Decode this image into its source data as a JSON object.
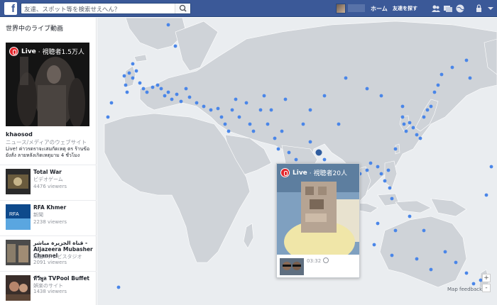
{
  "header": {
    "search_placeholder": "友達、スポット等を検索せえへん？",
    "nav_home": "ホーム",
    "nav_find_friends": "友達を探す"
  },
  "sidebar": {
    "title": "世界中のライブ動画",
    "featured": {
      "live_label": "Live",
      "viewers": "· 視聴者1.5万人",
      "name": "khaosod",
      "category": "ニュース/メディアのウェブサイト",
      "description": "Live! ค่าวรดราจะเสมกัดเหตุ ตร ร้านข้อยังสั่ง ลายหลังเกิดเหตุมาม 4 ชั่วโมง"
    },
    "streams": [
      {
        "name": "Total War",
        "category": "ビデオゲーム",
        "viewers": "4476 viewers"
      },
      {
        "name": "RFA Khmer",
        "category": "新聞",
        "viewers": "2238 viewers"
      },
      {
        "name": "قناة الجزيرة مباشر - Aljazeera Mubasher Channel",
        "category": "映画&テレビスタジオ",
        "viewers": "2091 viewers"
      },
      {
        "name": "ทีวีพูล TVPool Buffet",
        "category": "娯楽のサイト",
        "viewers": "1438 viewers"
      }
    ]
  },
  "popup": {
    "live_label": "Live",
    "viewers": "· 視聴者20人",
    "duration": "03:32"
  },
  "map": {
    "zoom_in": "+",
    "zoom_out": "-",
    "feedback": "Map feedback",
    "land_color": "#cfd3d8",
    "water_color": "#eaedf0",
    "dot_color": "#4a86e8"
  }
}
